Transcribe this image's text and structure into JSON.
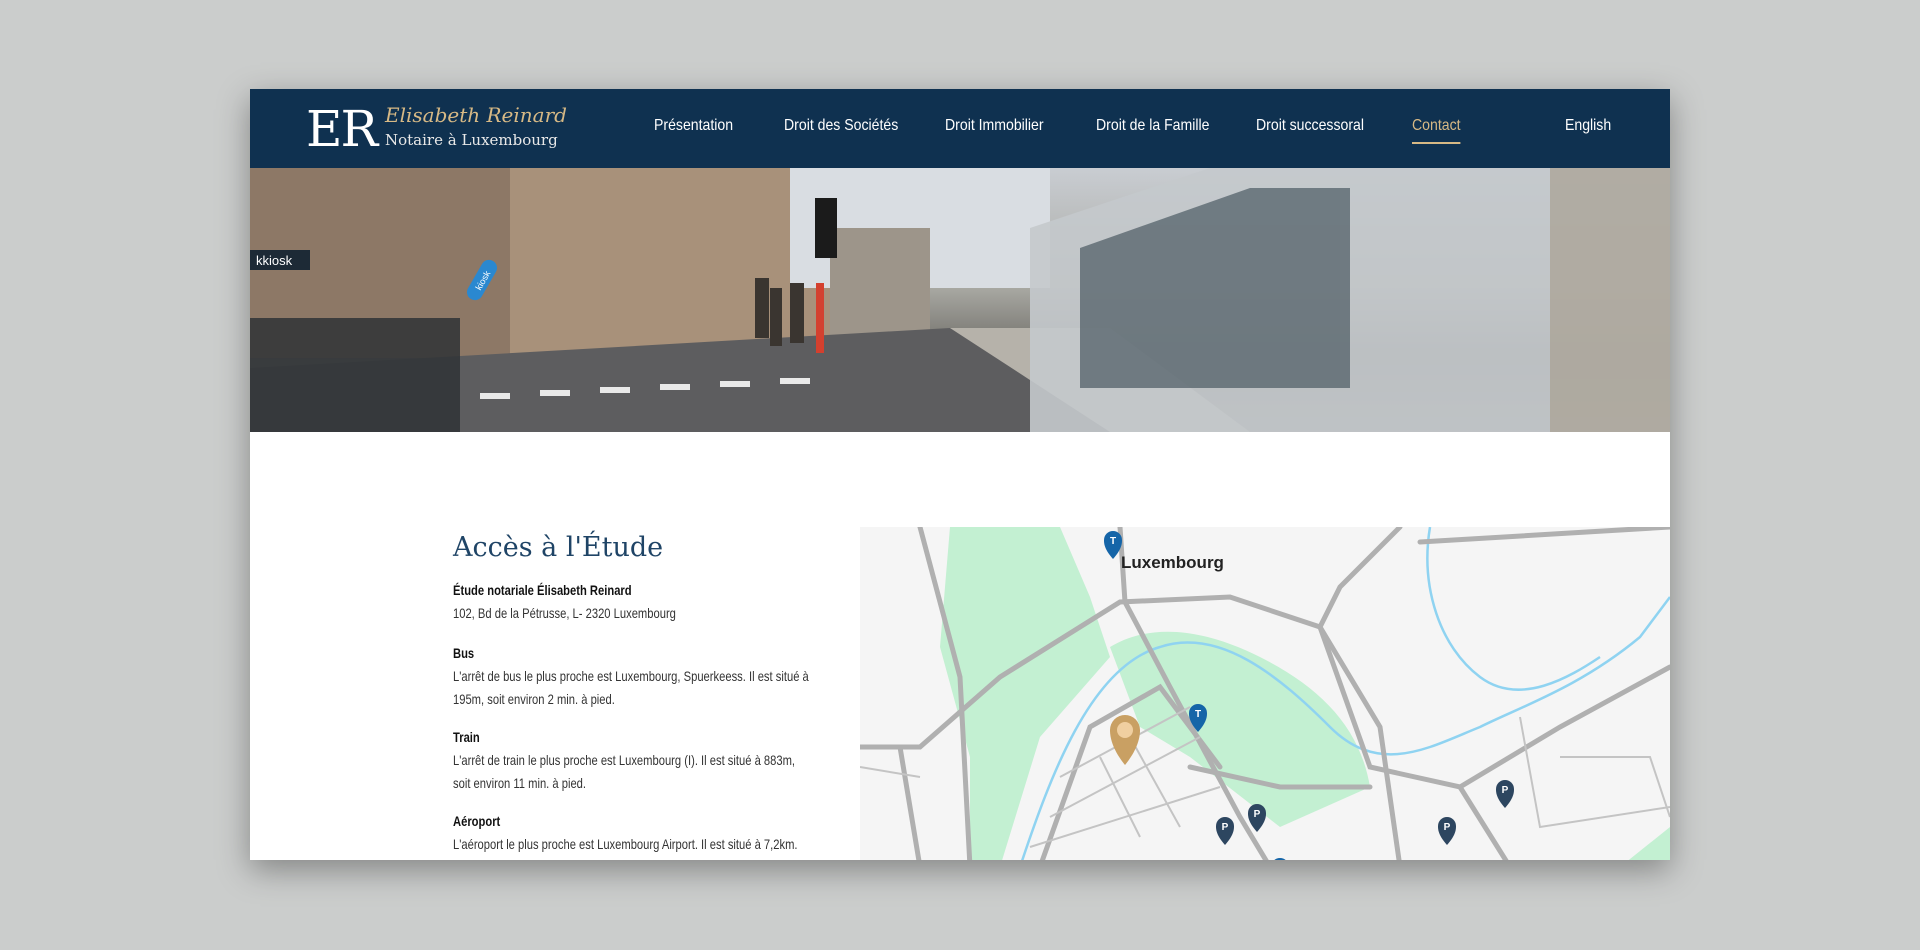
{
  "header": {
    "logo_mark": "ER",
    "logo_name": "Elisabeth Reinard",
    "logo_subtitle": "Notaire à Luxembourg",
    "nav": [
      {
        "label": "Présentation",
        "active": false
      },
      {
        "label": "Droit des Sociétés",
        "active": false
      },
      {
        "label": "Droit Immobilier",
        "active": false
      },
      {
        "label": "Droit de la Famille",
        "active": false
      },
      {
        "label": "Droit successoral",
        "active": false
      },
      {
        "label": "Contact",
        "active": true
      }
    ],
    "language": "English",
    "colors": {
      "background": "#0f3150",
      "accent": "#d7b985"
    }
  },
  "hero": {
    "signs": [
      "kkiosk",
      "kiosk"
    ]
  },
  "access": {
    "title": "Accès à l'Étude",
    "office_name": "Étude notariale Élisabeth Reinard",
    "address": "102, Bd de la Pétrusse, L- 2320 Luxembourg",
    "sections": [
      {
        "heading": "Bus",
        "text": "L'arrêt de bus le plus proche est Luxembourg, Spuerkeess. Il est situé à 195m, soit environ 2 min. à pied."
      },
      {
        "heading": "Train",
        "text": "L'arrêt de train le plus proche est Luxembourg (I). Il est situé à 883m, soit environ 11 min. à pied."
      },
      {
        "heading": "Aéroport",
        "text": "L'aéroport le plus proche est Luxembourg Airport. Il est situé à 7,2km."
      }
    ]
  },
  "map": {
    "city_label": "Luxembourg",
    "markers": [
      {
        "type": "office",
        "icon": "location-pin-icon",
        "color": "#c9a063"
      },
      {
        "type": "tram",
        "label": "T",
        "color": "#1565a8"
      },
      {
        "type": "tram",
        "label": "T",
        "color": "#1565a8"
      },
      {
        "type": "parking",
        "label": "P",
        "color": "#2d4660"
      },
      {
        "type": "parking",
        "label": "P",
        "color": "#2d4660"
      },
      {
        "type": "parking",
        "label": "P",
        "color": "#2d4660"
      },
      {
        "type": "parking",
        "label": "P",
        "color": "#2d4660"
      }
    ]
  }
}
